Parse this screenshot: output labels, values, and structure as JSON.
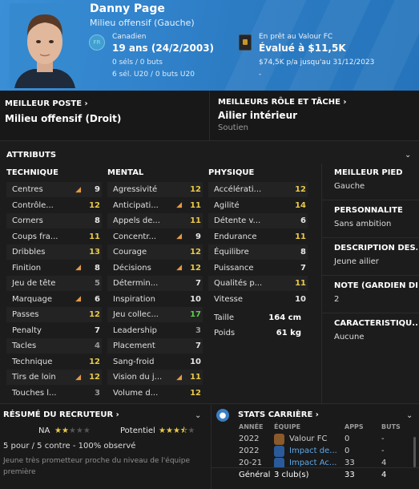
{
  "header": {
    "name": "Danny Page",
    "position": "Milieu offensif (Gauche)",
    "flag_code": "FR",
    "nationality": "Canadien",
    "age": "19 ans",
    "birth": "(24/2/2003)",
    "senior_stats": "0 séls / 0 buts",
    "u20_stats": "6 sél. U20 / 0 buts U20",
    "loan_text": "En prêt au Valour FC",
    "value": "Évalué à $11,5K",
    "wage": "$74,5K p/a jusqu'au 31/12/2023",
    "dash": "-"
  },
  "best_position": {
    "title": "MEILLEUR POSTE",
    "value": "Milieu offensif (Droit)"
  },
  "best_role": {
    "title": "MEILLEURS RÔLE ET TÂCHE",
    "value": "Ailier intérieur",
    "duty": "Soutien"
  },
  "attributes": {
    "title": "ATTRIBUTS",
    "technique": {
      "title": "TECHNIQUE",
      "rows": [
        {
          "name": "Centres",
          "value": "9",
          "color": "w",
          "arrow": true
        },
        {
          "name": "Contrôle...",
          "value": "12",
          "color": "y",
          "arrow": false
        },
        {
          "name": "Corners",
          "value": "8",
          "color": "w",
          "arrow": false
        },
        {
          "name": "Coups fra...",
          "value": "11",
          "color": "y",
          "arrow": false
        },
        {
          "name": "Dribbles",
          "value": "13",
          "color": "y",
          "arrow": false
        },
        {
          "name": "Finition",
          "value": "8",
          "color": "w",
          "arrow": true
        },
        {
          "name": "Jeu de tête",
          "value": "5",
          "color": "g",
          "arrow": false
        },
        {
          "name": "Marquage",
          "value": "6",
          "color": "w",
          "arrow": true
        },
        {
          "name": "Passes",
          "value": "12",
          "color": "y",
          "arrow": false
        },
        {
          "name": "Penalty",
          "value": "7",
          "color": "w",
          "arrow": false
        },
        {
          "name": "Tacles",
          "value": "4",
          "color": "g",
          "arrow": false
        },
        {
          "name": "Technique",
          "value": "12",
          "color": "y",
          "arrow": false
        },
        {
          "name": "Tirs de loin",
          "value": "12",
          "color": "y",
          "arrow": true
        },
        {
          "name": "Touches l...",
          "value": "3",
          "color": "g",
          "arrow": false
        }
      ]
    },
    "mental": {
      "title": "MENTAL",
      "rows": [
        {
          "name": "Agressivité",
          "value": "12",
          "color": "y",
          "arrow": false
        },
        {
          "name": "Anticipati...",
          "value": "11",
          "color": "y",
          "arrow": true
        },
        {
          "name": "Appels de...",
          "value": "11",
          "color": "y",
          "arrow": false
        },
        {
          "name": "Concentr...",
          "value": "9",
          "color": "w",
          "arrow": true
        },
        {
          "name": "Courage",
          "value": "12",
          "color": "y",
          "arrow": false
        },
        {
          "name": "Décisions",
          "value": "12",
          "color": "y",
          "arrow": true
        },
        {
          "name": "Détermin...",
          "value": "7",
          "color": "w",
          "arrow": false
        },
        {
          "name": "Inspiration",
          "value": "10",
          "color": "w",
          "arrow": false
        },
        {
          "name": "Jeu collec...",
          "value": "17",
          "color": "gr",
          "arrow": false
        },
        {
          "name": "Leadership",
          "value": "3",
          "color": "g",
          "arrow": false
        },
        {
          "name": "Placement",
          "value": "7",
          "color": "w",
          "arrow": false
        },
        {
          "name": "Sang-froid",
          "value": "10",
          "color": "w",
          "arrow": false
        },
        {
          "name": "Vision du j...",
          "value": "11",
          "color": "y",
          "arrow": true
        },
        {
          "name": "Volume d...",
          "value": "12",
          "color": "y",
          "arrow": false
        }
      ]
    },
    "physique": {
      "title": "PHYSIQUE",
      "rows": [
        {
          "name": "Accélérati...",
          "value": "12",
          "color": "y",
          "arrow": false
        },
        {
          "name": "Agilité",
          "value": "14",
          "color": "y",
          "arrow": false
        },
        {
          "name": "Détente v...",
          "value": "6",
          "color": "w",
          "arrow": false
        },
        {
          "name": "Endurance",
          "value": "11",
          "color": "y",
          "arrow": false
        },
        {
          "name": "Équilibre",
          "value": "8",
          "color": "w",
          "arrow": false
        },
        {
          "name": "Puissance",
          "value": "7",
          "color": "w",
          "arrow": false
        },
        {
          "name": "Qualités p...",
          "value": "11",
          "color": "y",
          "arrow": false
        },
        {
          "name": "Vitesse",
          "value": "10",
          "color": "w",
          "arrow": false
        }
      ],
      "height_label": "Taille",
      "height_value": "164 cm",
      "weight_label": "Poids",
      "weight_value": "61 kg"
    }
  },
  "sidebar": {
    "foot_title": "MEILLEUR PIED",
    "foot_value": "Gauche",
    "personality_title": "PERSONNALITÉ",
    "personality_value": "Sans ambition",
    "description_title": "DESCRIPTION DES...",
    "description_value": "Jeune ailier",
    "note_title": "NOTE (GARDIEN DE...",
    "note_value": "2",
    "traits_title": "CARACTÉRISTIQU...",
    "traits_value": "Aucune"
  },
  "scout": {
    "title": "RÉSUMÉ DU RECRUTEUR",
    "current_label": "NA",
    "current_stars": 2,
    "potential_label": "Potentiel",
    "potential_stars": 3.5,
    "summary": "5 pour / 5 contre - 100% observé",
    "comment": "Jeune très prometteur proche du niveau de l'équipe première"
  },
  "career": {
    "title": "STATS CARRIÈRE",
    "col_year": "ANNÉE",
    "col_team": "ÉQUIPE",
    "col_apps": "APPS",
    "col_goals": "BUTS",
    "rows": [
      {
        "year": "2022",
        "team": "Valour FC",
        "apps": "0",
        "goals": "-"
      },
      {
        "year": "2022",
        "team": "Impact de...",
        "apps": "0",
        "goals": "-"
      },
      {
        "year": "20-21",
        "team": "Impact Ac...",
        "apps": "33",
        "goals": "4"
      }
    ],
    "total_label": "Général",
    "total_clubs": "3 club(s)",
    "total_apps": "33",
    "total_goals": "4"
  }
}
